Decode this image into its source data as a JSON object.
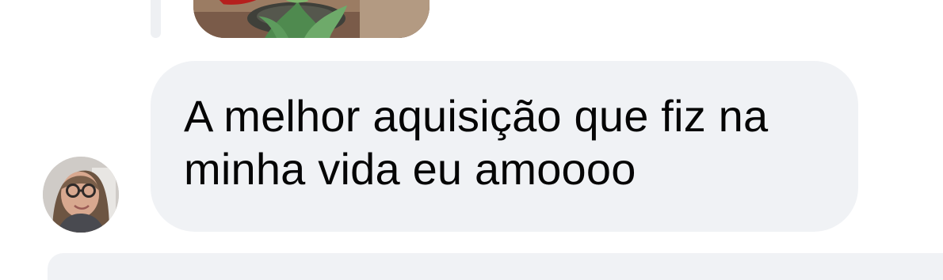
{
  "comment": {
    "text": "A melhor aquisição que fiz na minha vida eu amoooo"
  },
  "icons": {
    "avatar": "profile-photo",
    "attachment": "tulip-photo"
  },
  "colors": {
    "bubble_background": "#f0f2f5",
    "text": "#050505",
    "page_background": "#ffffff"
  }
}
